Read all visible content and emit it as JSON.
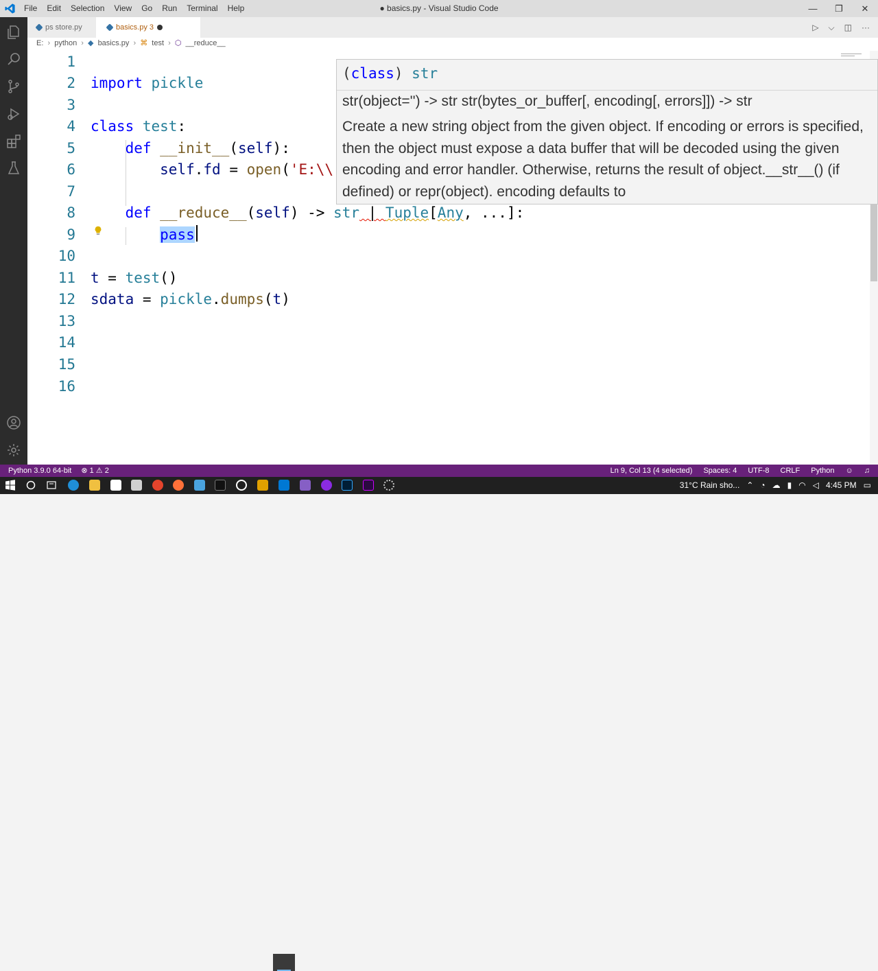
{
  "window": {
    "title": "● basics.py - Visual Studio Code",
    "controls": {
      "minimize": "—",
      "restore": "❐",
      "close": "✕"
    }
  },
  "menu": [
    "File",
    "Edit",
    "Selection",
    "View",
    "Go",
    "Run",
    "Terminal",
    "Help"
  ],
  "tabs": [
    {
      "label": "ps store.py"
    },
    {
      "label": "basics.py 3"
    }
  ],
  "tab_actions": {
    "run": "▷",
    "run_dropdown": "⌵",
    "split": "◫",
    "more": "···"
  },
  "breadcrumb": [
    "E:",
    "python",
    "basics.py",
    "test",
    "__reduce__"
  ],
  "editor": {
    "line_numbers": [
      "1",
      "2",
      "3",
      "4",
      "5",
      "6",
      "7",
      "8",
      "9",
      "10",
      "11",
      "12",
      "13",
      "14",
      "15",
      "16"
    ],
    "code": {
      "l2_kw": "import",
      "l2_mod": " pickle",
      "l4_kw": "class",
      "l4_name": " test",
      "l4_colon": ":",
      "l5_kw": "def",
      "l5_fn": " __init__",
      "l5_p1": "(",
      "l5_self": "self",
      "l5_p2": "):",
      "l6_self": "self",
      "l6_dot": ".",
      "l6_fd": "fd",
      "l6_eq": " = ",
      "l6_fn": "open",
      "l6_p": "(",
      "l6_str": "'E:\\\\",
      "l8_kw": "def",
      "l8_fn": " __reduce__",
      "l8_p1": "(",
      "l8_self": "self",
      "l8_p2": ") -> ",
      "l8_str": "str",
      "l8_bar": " | ",
      "l8_tuple": "Tuple",
      "l8_b1": "[",
      "l8_any": "Any",
      "l8_rest": ", ...]:",
      "l9_kw": "pass",
      "l11_t": "t",
      "l11_eq": " = ",
      "l11_fn": "test",
      "l11_p": "()",
      "l12_var": "sdata",
      "l12_eq": " = ",
      "l12_mod": "pickle",
      "l12_dot": ".",
      "l12_fn": "dumps",
      "l12_p1": "(",
      "l12_t": "t",
      "l12_p2": ")"
    }
  },
  "hover": {
    "sig_paren_open": "(",
    "sig_kw": "class",
    "sig_paren_close": ") ",
    "sig_name": "str",
    "doc_line1": "str(object='') -> str str(bytes_or_buffer[, encoding[, errors]]) -> str",
    "doc_paragraph": "Create a new string object from the given object. If encoding or errors is specified, then the object must expose a data buffer that will be decoded using the given encoding and error handler. Otherwise, returns the result of object.__str__() (if defined) or repr(object). encoding defaults to"
  },
  "statusbar": {
    "interpreter": "Python 3.9.0 64-bit",
    "errors": "⊗ 1",
    "warnings": "⚠ 2",
    "cursor": "Ln 9, Col 13 (4 selected)",
    "spaces": "Spaces: 4",
    "encoding": "UTF-8",
    "eol": "CRLF",
    "language": "Python",
    "color": "#68217a"
  },
  "taskbar": {
    "weather": "31°C  Rain sho...",
    "time": "4:45 PM",
    "caret": "⌃"
  },
  "colors": {
    "accent": "#68217a",
    "keyword": "#0000ff",
    "type": "#267f99",
    "function": "#795e26",
    "string": "#a31515",
    "line_number": "#237893"
  }
}
